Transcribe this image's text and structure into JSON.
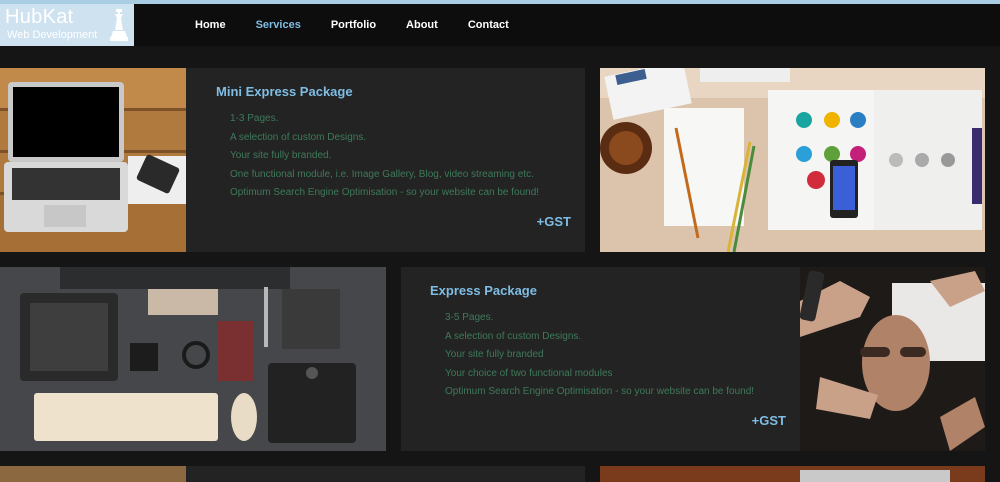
{
  "header": {
    "brand": {
      "name": "HubKat",
      "tagline": "Web Development"
    },
    "nav": [
      {
        "label": "Home"
      },
      {
        "label": "Services",
        "active": true
      },
      {
        "label": "Portfolio"
      },
      {
        "label": "About"
      },
      {
        "label": "Contact"
      }
    ]
  },
  "packages": [
    {
      "title": "Mini Express Package",
      "features": [
        "1-3 Pages.",
        "A selection of custom Designs.",
        "Your site fully branded.",
        "One functional module, i.e. Image Gallery, Blog, video streaming etc.",
        "Optimum Search Engine Optimisation - so your website can be found!"
      ],
      "price_note": "+GST"
    },
    {
      "title": "Express Package",
      "features": [
        "3-5 Pages.",
        "A selection of custom Designs.",
        "Your site fully branded",
        "Your choice of two functional modules",
        "Optimum Search Engine Optimisation - so your website can be found!"
      ],
      "price_note": "+GST"
    }
  ],
  "colors": {
    "accent": "#7fbde4",
    "feature_text": "#3e7a5a",
    "panel_bg": "#232323",
    "page_bg": "#151515"
  }
}
